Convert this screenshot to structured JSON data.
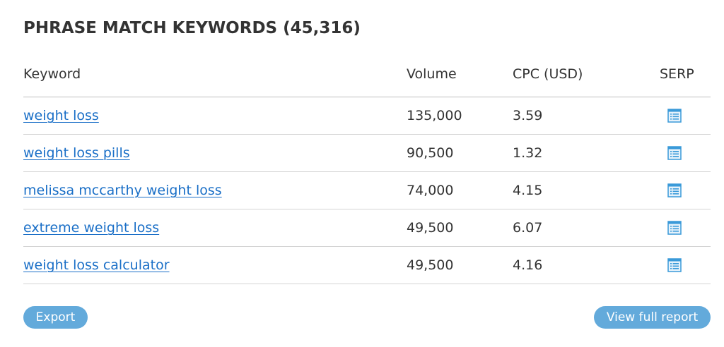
{
  "widget": {
    "title": "PHRASE MATCH KEYWORDS (45,316)"
  },
  "table": {
    "columns": {
      "keyword": "Keyword",
      "volume": "Volume",
      "cpc": "CPC (USD)",
      "serp": "SERP"
    },
    "rows": [
      {
        "keyword": "weight loss",
        "volume": "135,000",
        "cpc": "3.59"
      },
      {
        "keyword": "weight loss pills",
        "volume": "90,500",
        "cpc": "1.32"
      },
      {
        "keyword": "melissa mccarthy weight loss",
        "volume": "74,000",
        "cpc": "4.15"
      },
      {
        "keyword": "extreme weight loss",
        "volume": "49,500",
        "cpc": "6.07"
      },
      {
        "keyword": "weight loss calculator",
        "volume": "49,500",
        "cpc": "4.16"
      }
    ],
    "serp_icon": "serp-list-icon"
  },
  "footer": {
    "export_label": "Export",
    "report_label": "View full report"
  },
  "colors": {
    "link": "#1a6fc7",
    "button": "#63aadb",
    "icon": "#3a9ad9"
  }
}
